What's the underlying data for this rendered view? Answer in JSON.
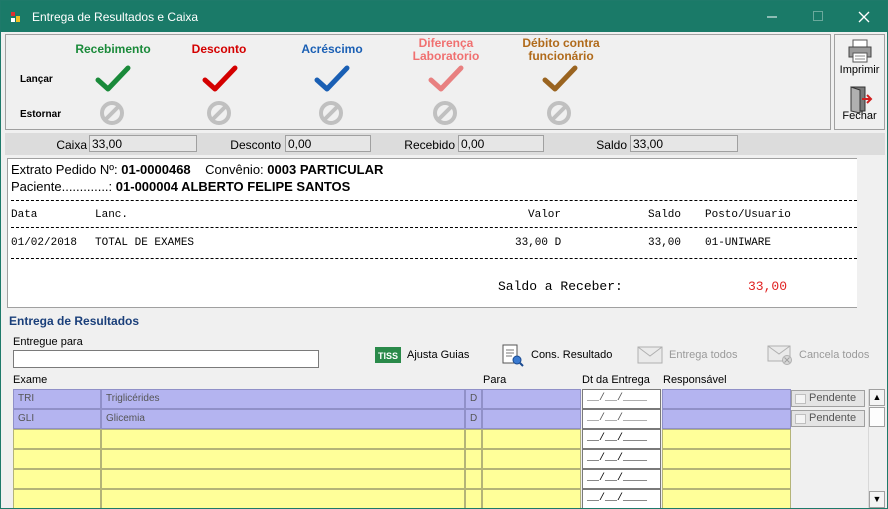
{
  "window": {
    "title": "Entrega de Resultados e Caixa"
  },
  "toolbar": {
    "lancar_label": "Lançar",
    "estornar_label": "Estornar",
    "columns": [
      {
        "title": "Recebimento",
        "color": "#1a8a3a",
        "check_color": "#1a8a3a"
      },
      {
        "title": "Desconto",
        "color": "#d40000",
        "check_color": "#d40000"
      },
      {
        "title": "Acréscimo",
        "color": "#1a5fb4",
        "check_color": "#1a5fb4"
      },
      {
        "title_lines": [
          "Diferença",
          "Laboratorio"
        ],
        "color": "#f07070",
        "check_color": "#e88080"
      },
      {
        "title_lines": [
          "Débito contra",
          "funcionário"
        ],
        "color": "#b06a1a",
        "check_color": "#9a6420"
      }
    ]
  },
  "side": {
    "imprimir": "Imprimir",
    "fechar": "Fechar"
  },
  "totals": {
    "caixa_label": "Caixa",
    "caixa_value": "33,00",
    "desconto_label": "Desconto",
    "desconto_value": "0,00",
    "recebido_label": "Recebido",
    "recebido_value": "0,00",
    "saldo_label": "Saldo",
    "saldo_value": "33,00"
  },
  "extrato": {
    "pedido_label": "Extrato Pedido Nº:",
    "pedido_value": "01-0000468",
    "convenio_label": "Convênio:",
    "convenio_value": "0003 PARTICULAR",
    "paciente_label": "Paciente.............:",
    "paciente_value": "01-000004 ALBERTO FELIPE SANTOS",
    "headers": {
      "data": "Data",
      "lanc": "Lanc.",
      "valor": "Valor",
      "saldo": "Saldo",
      "posto": "Posto/Usuario"
    },
    "row": {
      "data": "01/02/2018",
      "lanc": "TOTAL DE EXAMES",
      "valor": "33,00 D",
      "saldo": "33,00",
      "posto": "01-UNIWARE"
    },
    "saldo_receber_label": "Saldo a Receber:",
    "saldo_receber_value": "33,00",
    "saldo_color": "#e02020"
  },
  "entrega": {
    "section_title": "Entregue de Resultados",
    "entregue_para_label": "Entregue para",
    "entregue_para_value": "",
    "ajusta_guias": "Ajusta Guias",
    "cons_resultado": "Cons. Resultado",
    "entrega_todos": "Entrega todos",
    "cancela_todos": "Cancela todos",
    "tiss_text": "TISS",
    "columns": {
      "exame": "Exame",
      "para": "Para",
      "dt_entrega": "Dt da Entrega",
      "responsavel": "Responsável"
    },
    "rows": [
      {
        "code": "TRI",
        "name": "Triglicérides",
        "flag": "D",
        "para": "",
        "dt": "__/__/____",
        "resp": "",
        "status": "Pendente"
      },
      {
        "code": "GLI",
        "name": "Glicemia",
        "flag": "D",
        "para": "",
        "dt": "__/__/____",
        "resp": "",
        "status": "Pendente"
      }
    ],
    "empty_date": "__/__/____"
  }
}
